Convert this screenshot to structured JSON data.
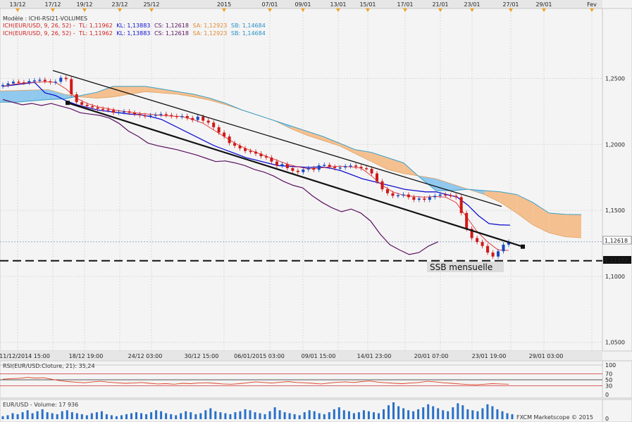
{
  "top_dates": [
    "13/12",
    "17/12",
    "19/12",
    "23/12",
    "25/12",
    "2015",
    "07/01",
    "09/01",
    "13/01",
    "15/01",
    "17/01",
    "21/01",
    "23/01",
    "27/01",
    "29/01",
    "Fev"
  ],
  "bottom_dates": [
    "11/12/2014 15:00",
    "18/12 19:00",
    "24/12 03:00",
    "30/12 15:00",
    "06/01/2015 03:00",
    "09/01 15:00",
    "14/01 23:00",
    "20/01 07:00",
    "23/01 19:00",
    "29/01 03:00"
  ],
  "legend": {
    "model": "Modèle : ICHI-RSI21-VOLUMES",
    "line1": {
      "name": "ICH(EUR/USD, 9, 26, 52) -",
      "tl": "TL: 1,11962",
      "kl": "KL: 1,13883",
      "cs": "CS: 1,12618",
      "sa": "SA: 1,12923",
      "sb": "SB: 1,14684"
    },
    "line2": {
      "name": "ICH(EUR/USD, 9, 26, 52) -",
      "tl": "TL: 1,11962",
      "kl": "KL: 1,13883",
      "cs": "CS: 1,12618",
      "sa": "SA: 1,12923",
      "sb": "SB: 1,14684"
    }
  },
  "annotation": "SSB mensuelle",
  "price_label": "1,12618",
  "ssb_label": "1,11177",
  "rsi_title": "RSI(EUR/USD:Cloture, 21): 35,24",
  "volume_title": "EUR/USD - Volume: 17 936",
  "footer": "FXCM Marketscope © 2015",
  "colors": {
    "tenkan": "#e03030",
    "kijun": "#1010d0",
    "chikou": "#5a1060",
    "cloud_bear": "#f5c090",
    "cloud_bull": "#90c8ee",
    "senkou_b": "#3aa0c8",
    "candle_up": "#1848c0",
    "candle_down": "#d01818",
    "volume": "#2a70c8"
  },
  "chart_data": [
    {
      "type": "candlestick",
      "title": "",
      "x_axis": "time",
      "y_ticks": [
        "1,2500",
        "1,2000",
        "1,1500",
        "1,1000",
        "1,0500"
      ],
      "ylim": [
        1.045,
        1.285
      ],
      "series": {
        "close": [
          1.245,
          1.2462,
          1.2475,
          1.247,
          1.2468,
          1.248,
          1.2485,
          1.249,
          1.2478,
          1.247,
          1.2475,
          1.2505,
          1.2495,
          1.238,
          1.232,
          1.23,
          1.229,
          1.228,
          1.227,
          1.2265,
          1.226,
          1.224,
          1.2245,
          1.225,
          1.224,
          1.223,
          1.222,
          1.2215,
          1.222,
          1.2225,
          1.223,
          1.2222,
          1.2215,
          1.221,
          1.2215,
          1.22,
          1.2185,
          1.221,
          1.218,
          1.2165,
          1.213,
          1.209,
          1.206,
          1.201,
          1.199,
          1.197,
          1.195,
          1.1945,
          1.193,
          1.191,
          1.19,
          1.187,
          1.184,
          1.185,
          1.182,
          1.18,
          1.179,
          1.181,
          1.182,
          1.1808,
          1.184,
          1.1845,
          1.183,
          1.182,
          1.1825,
          1.1835,
          1.184,
          1.183,
          1.182,
          1.1815,
          1.178,
          1.172,
          1.166,
          1.163,
          1.161,
          1.1615,
          1.162,
          1.16,
          1.158,
          1.159,
          1.158,
          1.16,
          1.161,
          1.162,
          1.1615,
          1.161,
          1.16,
          1.148,
          1.136,
          1.129,
          1.126,
          1.123,
          1.118,
          1.115,
          1.119,
          1.124,
          1.1262
        ],
        "tenkan": [
          1.244,
          1.2455,
          1.2465,
          1.247,
          1.2475,
          1.247,
          1.242,
          1.235,
          1.231,
          1.2285,
          1.227,
          1.2255,
          1.2245,
          1.2235,
          1.2228,
          1.222,
          1.2215,
          1.221,
          1.219,
          1.216,
          1.211,
          1.206,
          1.201,
          1.197,
          1.194,
          1.191,
          1.188,
          1.185,
          1.183,
          1.1815,
          1.182,
          1.183,
          1.1835,
          1.183,
          1.182,
          1.176,
          1.169,
          1.164,
          1.1615,
          1.1605,
          1.16,
          1.1605,
          1.16,
          1.156,
          1.145,
          1.134,
          1.126,
          1.12,
          1.1196
        ],
        "kijun": [
          1.244,
          1.245,
          1.246,
          1.247,
          1.239,
          1.237,
          1.233,
          1.23,
          1.228,
          1.226,
          1.225,
          1.224,
          1.223,
          1.2225,
          1.221,
          1.219,
          1.215,
          1.211,
          1.207,
          1.203,
          1.199,
          1.196,
          1.193,
          1.19,
          1.188,
          1.186,
          1.184,
          1.1835,
          1.183,
          1.1825,
          1.183,
          1.182,
          1.18,
          1.177,
          1.174,
          1.172,
          1.17,
          1.168,
          1.166,
          1.165,
          1.164,
          1.164,
          1.162,
          1.16,
          1.154,
          1.146,
          1.14,
          1.139,
          1.1388
        ],
        "chikou": [
          1.234,
          1.232,
          1.23,
          1.231,
          1.2295,
          1.231,
          1.229,
          1.227,
          1.224,
          1.223,
          1.222,
          1.22,
          1.216,
          1.21,
          1.206,
          1.201,
          1.199,
          1.1975,
          1.196,
          1.194,
          1.192,
          1.1895,
          1.187,
          1.1875,
          1.186,
          1.184,
          1.181,
          1.179,
          1.176,
          1.172,
          1.169,
          1.167,
          1.161,
          1.156,
          1.152,
          1.149,
          1.151,
          1.148,
          1.142,
          1.132,
          1.124,
          1.12,
          1.1165,
          1.118,
          1.123,
          1.1262
        ],
        "senkou_a": [
          1.2405,
          1.2408,
          1.2412,
          1.2415,
          1.238,
          1.236,
          1.235,
          1.236,
          1.238,
          1.24,
          1.239,
          1.238,
          1.236,
          1.2335,
          1.23,
          1.226,
          1.222,
          1.218,
          1.212,
          1.207,
          1.203,
          1.199,
          1.193,
          1.187,
          1.181,
          1.178,
          1.176,
          1.174,
          1.17,
          1.166,
          1.162,
          1.156,
          1.148,
          1.139,
          1.133,
          1.13,
          1.1292
        ],
        "senkou_b": [
          1.232,
          1.232,
          1.233,
          1.234,
          1.2345,
          1.237,
          1.2395,
          1.244,
          1.244,
          1.244,
          1.242,
          1.24,
          1.238,
          1.235,
          1.231,
          1.226,
          1.222,
          1.218,
          1.214,
          1.21,
          1.206,
          1.201,
          1.196,
          1.194,
          1.19,
          1.186,
          1.175,
          1.165,
          1.165,
          1.166,
          1.165,
          1.164,
          1.162,
          1.156,
          1.148,
          1.147,
          1.1468
        ]
      },
      "trendlines": [
        {
          "role": "upper channel",
          "from": 1.256,
          "to": 1.153
        },
        {
          "role": "lower channel",
          "from": 1.2315,
          "to": 1.1225
        }
      ],
      "horizontal_level": {
        "label": "SSB mensuelle",
        "value": 1.1118
      }
    },
    {
      "type": "line",
      "title": "RSI(EUR/USD:Cloture, 21): 35,24",
      "y_ticks": [
        "100",
        "70",
        "50",
        "30",
        "0"
      ],
      "levels": [
        70,
        50,
        30
      ],
      "ylim": [
        0,
        100
      ],
      "values": [
        52,
        54,
        55,
        58,
        56,
        57,
        52,
        47,
        44,
        42,
        40,
        43,
        45,
        42,
        40,
        38,
        39,
        41,
        38,
        36,
        37,
        35,
        38,
        37,
        39,
        40,
        38,
        36,
        35,
        37,
        40,
        43,
        41,
        39,
        42,
        44,
        41,
        40,
        38,
        36,
        39,
        42,
        43,
        41,
        44,
        46,
        42,
        40,
        38,
        37,
        39,
        41,
        45,
        43,
        40,
        38,
        36,
        34,
        33,
        35,
        37,
        36,
        35
      ]
    },
    {
      "type": "bar",
      "title": "EUR/USD - Volume: 17 936",
      "y_ticks": [
        "0"
      ],
      "values": [
        3,
        4,
        6,
        5,
        7,
        9,
        6,
        8,
        10,
        7,
        6,
        5,
        8,
        9,
        7,
        6,
        5,
        4,
        6,
        7,
        8,
        5,
        4,
        3,
        4,
        5,
        6,
        7,
        6,
        5,
        7,
        9,
        8,
        6,
        5,
        4,
        6,
        8,
        7,
        5,
        6,
        9,
        11,
        8,
        7,
        6,
        5,
        7,
        8,
        10,
        9,
        7,
        6,
        5,
        8,
        12,
        9,
        7,
        6,
        5,
        4,
        7,
        9,
        8,
        6,
        5,
        7,
        10,
        12,
        9,
        8,
        6,
        7,
        9,
        8,
        7,
        6,
        10,
        14,
        17,
        13,
        11,
        9,
        8,
        10,
        12,
        15,
        13,
        11,
        9,
        8,
        12,
        16,
        14,
        10,
        9,
        8,
        11,
        15,
        13,
        10,
        8,
        6,
        5
      ]
    }
  ]
}
